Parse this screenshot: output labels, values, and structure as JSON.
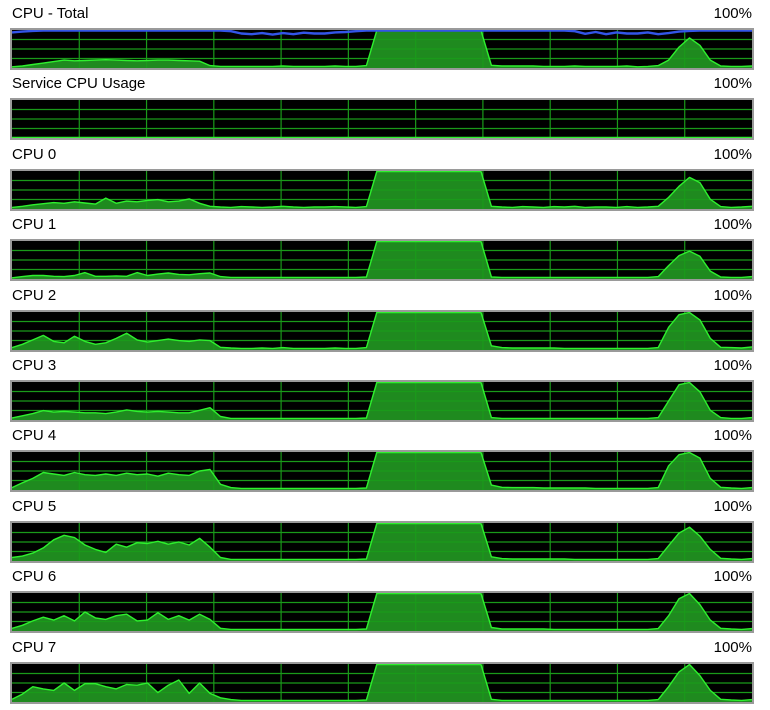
{
  "colors": {
    "graph_background": "#000000",
    "grid": "#1a9a1a",
    "cpu_fill": "#1f8a1f",
    "cpu_line": "#2ef02e",
    "total_line": "#3355e8",
    "frame": "#9a9a9a"
  },
  "panels": [
    {
      "label": "CPU - Total",
      "scale": "100%",
      "values": [
        2,
        4,
        8,
        12,
        16,
        20,
        18,
        19,
        20,
        21,
        20,
        19,
        18,
        19,
        20,
        20,
        19,
        18,
        17,
        5,
        3,
        3,
        3,
        3,
        3,
        3,
        4,
        3,
        3,
        3,
        3,
        4,
        3,
        3,
        5,
        100,
        100,
        100,
        100,
        100,
        100,
        100,
        100,
        100,
        100,
        100,
        6,
        4,
        4,
        4,
        4,
        3,
        3,
        3,
        4,
        3,
        3,
        3,
        3,
        4,
        2,
        3,
        5,
        20,
        55,
        80,
        60,
        20,
        4,
        3,
        3,
        4
      ],
      "total_values": [
        95,
        97,
        99,
        100,
        100,
        100,
        100,
        100,
        100,
        100,
        100,
        100,
        100,
        100,
        100,
        100,
        100,
        100,
        100,
        100,
        100,
        98,
        92,
        90,
        93,
        89,
        93,
        90,
        94,
        92,
        92,
        95,
        96,
        98,
        100,
        100,
        100,
        100,
        100,
        100,
        100,
        100,
        100,
        100,
        100,
        100,
        100,
        100,
        100,
        100,
        100,
        100,
        100,
        100,
        98,
        91,
        96,
        90,
        95,
        92,
        92,
        95,
        90,
        93,
        97,
        99,
        100,
        100,
        100,
        100,
        100,
        100
      ]
    },
    {
      "label": "Service CPU Usage",
      "scale": "100%",
      "values": [
        0,
        0,
        0,
        0,
        0,
        0,
        0,
        0,
        0,
        0,
        0,
        0,
        0,
        0,
        0,
        0,
        0,
        0,
        0,
        0,
        0,
        0,
        0,
        0,
        0,
        0,
        0,
        0,
        0,
        0,
        0,
        0,
        0,
        0,
        0,
        0,
        0,
        0,
        0,
        0,
        0,
        0,
        0,
        0,
        0,
        0,
        0,
        0,
        0,
        0,
        0,
        0,
        0,
        0,
        0,
        0,
        0,
        0,
        0,
        0,
        0,
        0,
        0,
        0,
        0,
        0,
        0,
        0,
        0,
        0,
        0,
        0
      ]
    },
    {
      "label": "CPU 0",
      "scale": "100%",
      "values": [
        3,
        6,
        10,
        13,
        16,
        14,
        18,
        15,
        12,
        28,
        14,
        20,
        18,
        22,
        24,
        18,
        20,
        26,
        14,
        6,
        4,
        3,
        5,
        4,
        3,
        4,
        6,
        4,
        3,
        4,
        4,
        5,
        4,
        3,
        5,
        100,
        100,
        100,
        100,
        100,
        100,
        100,
        100,
        100,
        100,
        100,
        6,
        4,
        3,
        5,
        4,
        3,
        5,
        4,
        6,
        3,
        4,
        4,
        3,
        5,
        3,
        4,
        6,
        30,
        60,
        84,
        70,
        25,
        5,
        3,
        4,
        6
      ]
    },
    {
      "label": "CPU 1",
      "scale": "100%",
      "values": [
        2,
        5,
        8,
        8,
        6,
        5,
        8,
        16,
        6,
        6,
        7,
        6,
        16,
        8,
        12,
        15,
        11,
        10,
        13,
        15,
        5,
        3,
        3,
        3,
        3,
        3,
        3,
        3,
        3,
        3,
        3,
        3,
        3,
        3,
        4,
        100,
        100,
        100,
        100,
        100,
        100,
        100,
        100,
        100,
        100,
        100,
        4,
        3,
        3,
        3,
        3,
        3,
        3,
        3,
        3,
        3,
        3,
        3,
        3,
        3,
        3,
        3,
        5,
        35,
        62,
        74,
        60,
        20,
        4,
        3,
        3,
        5
      ]
    },
    {
      "label": "CPU 2",
      "scale": "100%",
      "values": [
        5,
        14,
        26,
        38,
        22,
        18,
        36,
        22,
        14,
        18,
        30,
        44,
        26,
        20,
        24,
        28,
        24,
        22,
        26,
        24,
        6,
        4,
        3,
        3,
        4,
        3,
        5,
        3,
        3,
        3,
        3,
        4,
        3,
        3,
        5,
        100,
        100,
        100,
        100,
        100,
        100,
        100,
        100,
        100,
        100,
        100,
        10,
        5,
        4,
        4,
        4,
        4,
        4,
        3,
        3,
        3,
        3,
        3,
        3,
        3,
        3,
        3,
        5,
        60,
        94,
        100,
        80,
        30,
        6,
        5,
        4,
        7
      ]
    },
    {
      "label": "CPU 3",
      "scale": "100%",
      "values": [
        4,
        10,
        16,
        24,
        20,
        22,
        20,
        18,
        18,
        16,
        20,
        26,
        22,
        20,
        22,
        20,
        18,
        18,
        25,
        32,
        8,
        3,
        3,
        3,
        3,
        3,
        3,
        3,
        3,
        3,
        3,
        3,
        3,
        3,
        4,
        100,
        100,
        100,
        100,
        100,
        100,
        100,
        100,
        100,
        100,
        100,
        5,
        3,
        3,
        3,
        3,
        3,
        3,
        3,
        3,
        3,
        3,
        3,
        3,
        3,
        3,
        3,
        5,
        50,
        94,
        100,
        75,
        25,
        5,
        3,
        3,
        5
      ]
    },
    {
      "label": "CPU 4",
      "scale": "100%",
      "values": [
        5,
        18,
        30,
        46,
        42,
        38,
        46,
        40,
        38,
        42,
        38,
        44,
        40,
        42,
        36,
        44,
        40,
        38,
        50,
        54,
        14,
        5,
        3,
        3,
        3,
        3,
        3,
        3,
        3,
        3,
        3,
        3,
        3,
        3,
        4,
        100,
        100,
        100,
        100,
        100,
        100,
        100,
        100,
        100,
        100,
        100,
        12,
        6,
        5,
        5,
        5,
        4,
        4,
        4,
        4,
        4,
        3,
        3,
        3,
        3,
        3,
        3,
        5,
        64,
        94,
        100,
        85,
        30,
        6,
        4,
        3,
        5
      ]
    },
    {
      "label": "CPU 5",
      "scale": "100%",
      "values": [
        8,
        12,
        20,
        34,
        56,
        68,
        62,
        42,
        30,
        22,
        44,
        36,
        48,
        46,
        52,
        44,
        50,
        42,
        60,
        36,
        8,
        3,
        3,
        3,
        3,
        3,
        3,
        3,
        3,
        3,
        3,
        3,
        3,
        3,
        4,
        100,
        100,
        100,
        100,
        100,
        100,
        100,
        100,
        100,
        100,
        100,
        10,
        5,
        4,
        4,
        4,
        4,
        4,
        4,
        3,
        3,
        3,
        3,
        3,
        3,
        3,
        3,
        5,
        40,
        74,
        90,
        66,
        30,
        6,
        4,
        3,
        5
      ]
    },
    {
      "label": "CPU 6",
      "scale": "100%",
      "values": [
        6,
        14,
        26,
        36,
        28,
        40,
        26,
        50,
        34,
        30,
        40,
        44,
        26,
        28,
        48,
        30,
        40,
        28,
        44,
        30,
        6,
        3,
        3,
        3,
        3,
        3,
        3,
        3,
        3,
        3,
        3,
        3,
        3,
        3,
        4,
        100,
        100,
        100,
        100,
        100,
        100,
        100,
        100,
        100,
        100,
        100,
        8,
        4,
        4,
        4,
        4,
        4,
        3,
        3,
        3,
        3,
        3,
        3,
        3,
        3,
        3,
        3,
        5,
        40,
        86,
        100,
        70,
        28,
        6,
        4,
        3,
        5
      ]
    },
    {
      "label": "CPU 7",
      "scale": "100%",
      "values": [
        6,
        20,
        40,
        34,
        30,
        50,
        30,
        48,
        48,
        40,
        34,
        46,
        44,
        50,
        24,
        44,
        58,
        22,
        50,
        22,
        10,
        5,
        3,
        3,
        3,
        3,
        3,
        3,
        3,
        3,
        3,
        3,
        3,
        3,
        4,
        100,
        100,
        100,
        100,
        100,
        100,
        100,
        100,
        100,
        100,
        100,
        6,
        3,
        3,
        3,
        3,
        3,
        3,
        3,
        3,
        3,
        3,
        3,
        3,
        3,
        3,
        3,
        5,
        40,
        80,
        100,
        70,
        30,
        6,
        4,
        3,
        5
      ]
    }
  ]
}
